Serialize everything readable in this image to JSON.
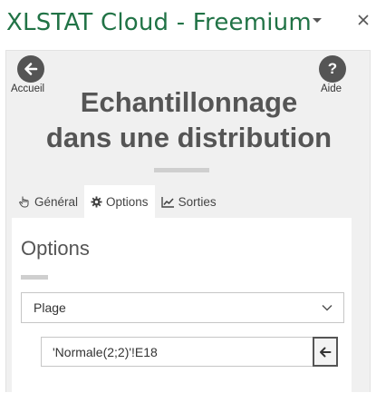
{
  "pane": {
    "title": "XLSTAT Cloud - Freemium"
  },
  "nav": {
    "back_label": "Accueil",
    "help_label": "Aide",
    "help_glyph": "?"
  },
  "dialog": {
    "title_line1": "Echantillonnage",
    "title_line2": "dans une distribution"
  },
  "tabs": [
    {
      "label": "Général",
      "icon": "hand-pointer-icon",
      "active": false
    },
    {
      "label": "Options",
      "icon": "gear-icon",
      "active": true
    },
    {
      "label": "Sorties",
      "icon": "line-chart-icon",
      "active": false
    }
  ],
  "options": {
    "heading": "Options",
    "select_value": "Plage",
    "range_value": "'Normale(2;2)'!E18"
  },
  "colors": {
    "brand_green": "#217346",
    "button_dark": "#555555"
  }
}
